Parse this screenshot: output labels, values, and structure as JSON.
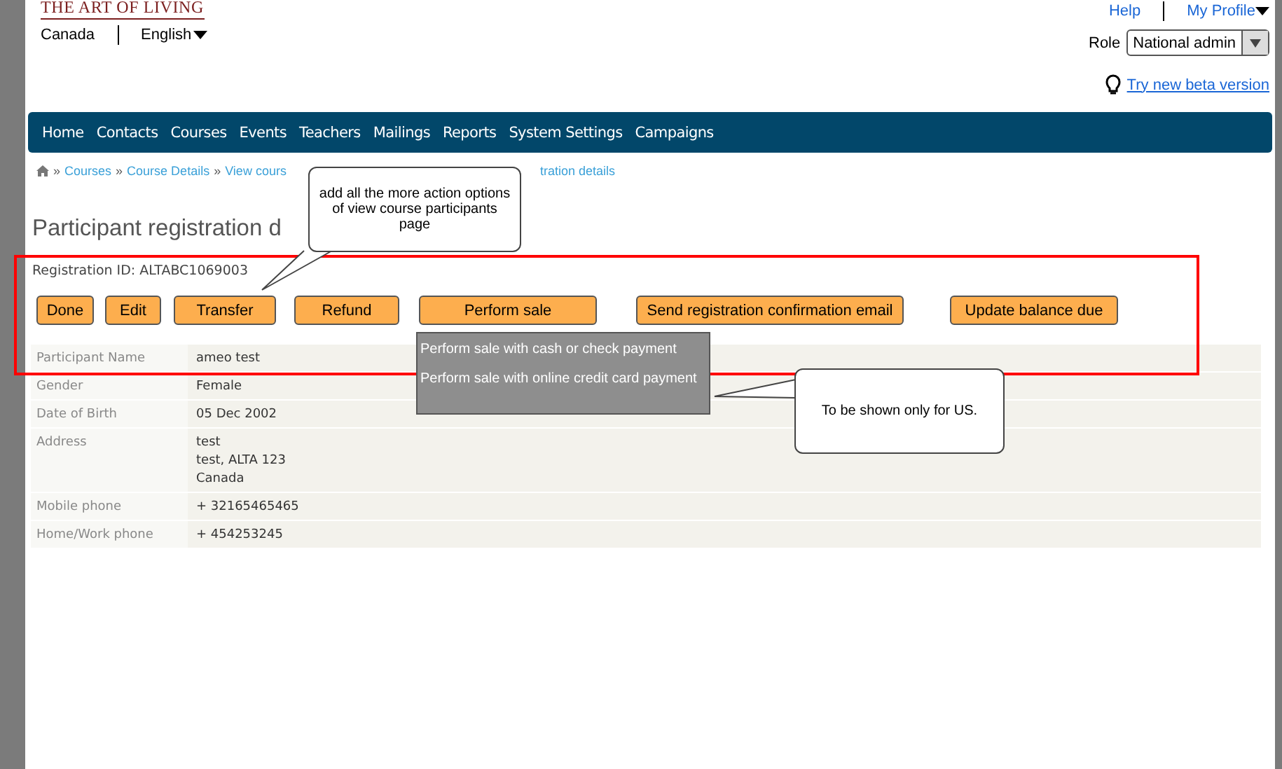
{
  "header": {
    "logo": "THE ART OF LIVING",
    "country": "Canada",
    "language": "English",
    "links": [
      "Help",
      "My Profile"
    ],
    "role_label": "Role",
    "role_value": "National admin",
    "beta_link": "Try new beta version"
  },
  "nav": [
    "Home",
    "Contacts",
    "Courses",
    "Events",
    "Teachers",
    "Mailings",
    "Reports",
    "System Settings",
    "Campaigns"
  ],
  "breadcrumb": [
    {
      "separator": "»",
      "label": "Courses"
    },
    {
      "separator": "»",
      "label": "Course Details"
    },
    {
      "separator": "»",
      "label": "View cours"
    }
  ],
  "breadcrumb_tail": "tration details",
  "title": "Participant registration d",
  "registration_id": "Registration ID: ALTABC1069003",
  "actions": [
    "Done",
    "Edit",
    "Transfer",
    "Refund",
    "Perform sale",
    "Send registration confirmation email",
    "Update balance due"
  ],
  "sale_menu": [
    "Perform sale with cash or check payment",
    "Perform sale with online credit card payment"
  ],
  "details": [
    {
      "label": "Participant Name",
      "lines": [
        "ameo test"
      ]
    },
    {
      "label": "Gender",
      "lines": [
        "Female"
      ]
    },
    {
      "label": "Date of Birth",
      "lines": [
        "05 Dec 2002"
      ]
    },
    {
      "label": "Address",
      "lines": [
        "test",
        "test, ALTA 123",
        "Canada"
      ]
    },
    {
      "label": "Mobile phone",
      "lines": [
        "+ 32165465465"
      ]
    },
    {
      "label": "Home/Work phone",
      "lines": [
        "+ 454253245"
      ]
    }
  ],
  "annotations": [
    {
      "text": "add all the more action options of view course participants page"
    },
    {
      "text": "To be shown only for US."
    }
  ]
}
